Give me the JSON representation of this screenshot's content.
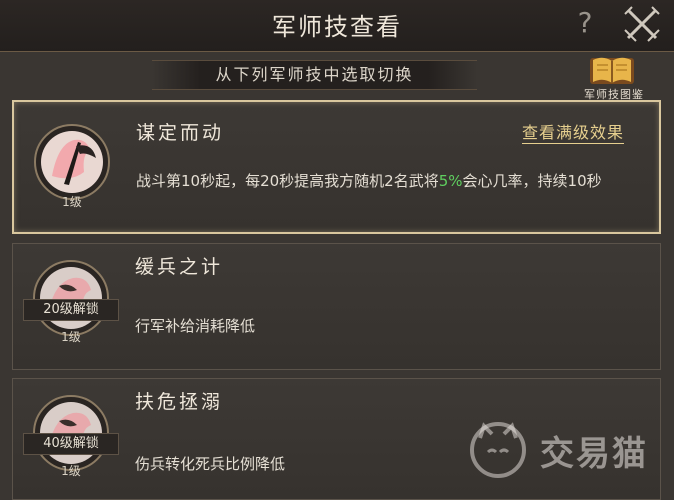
{
  "header": {
    "title": "军师技查看",
    "help": "?"
  },
  "subtitle": "从下列军师技中选取切换",
  "codex": {
    "label": "军师技图鉴"
  },
  "skills": [
    {
      "name": "谋定而动",
      "level": "1级",
      "max_link": "查看满级效果",
      "desc_pre": "战斗第10秒起，每20秒提高我方随机2名武将",
      "desc_hl": "5%",
      "desc_post": "会心几率，持续10秒",
      "selected": true
    },
    {
      "name": "缓兵之计",
      "level": "1级",
      "unlock": "20级解锁",
      "desc": "行军补给消耗降低"
    },
    {
      "name": "扶危拯溺",
      "level": "1级",
      "unlock": "40级解锁",
      "desc": "伤兵转化死兵比例降低"
    }
  ],
  "watermark": {
    "text": "交易猫"
  },
  "colors": {
    "highlight": "#5fcf5f",
    "link": "#e6cf8e",
    "selected_border": "#d9c79e"
  }
}
